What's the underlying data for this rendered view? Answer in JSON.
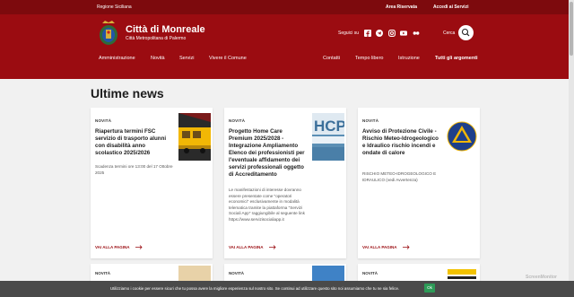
{
  "topbar": {
    "region": "Regione Siciliana",
    "reserved": "Area Riservata",
    "services": "Accedi ai Servizi"
  },
  "header": {
    "title": "Città di Monreale",
    "subtitle": "Città Metropolitana di Palermo",
    "social_label": "Seguici su",
    "social_icons": [
      "facebook-icon",
      "telegram-icon",
      "instagram-icon",
      "youtube-icon",
      "flickr-icon"
    ],
    "search_label": "Cerca",
    "nav_left": [
      "Amministrazione",
      "Novità",
      "Servizi",
      "Vivere il Comune"
    ],
    "nav_right": [
      "Contatti",
      "Tempo libero",
      "Istruzione",
      "Tutti gli argomenti"
    ]
  },
  "main": {
    "title": "Ultime news",
    "read_more": "VAI ALLA PAGINA",
    "cards": [
      {
        "category": "NOVITÀ",
        "title": "Riapertura termini FSC servizio di trasporto alunni con disabilità anno scolastico 2025/2026",
        "excerpt": "Scadenza termini ore 13:00 del 17 Ottobre 2025"
      },
      {
        "category": "NOVITÀ",
        "title": "Progetto Home Care Premium 2025/2028 - Integrazione Ampliamento Elenco dei professionisti per l'eventuale affidamento dei servizi professionali oggetto di Accreditamento",
        "excerpt": "Le manifestazioni di interesse dovranno essere presentate come \"operatori economici\" esclusivamente in modalità telematica tramite la piattaforma \"Servizi Sociali App\" raggiungibile al seguente link https://www.servizisocialiapp.it"
      },
      {
        "category": "NOVITÀ",
        "title": "Avviso di Protezione Civile - Rischio Meteo-Idrogeologico e Idraulico rischio incendi e ondate di calore",
        "excerpt": "RISCHIO METEO-IDROGEOLOGICO E IDRAULICO (vedi Avvertenza)"
      }
    ],
    "row2_categories": [
      "NOVITÀ",
      "NOVITÀ",
      "NOVITÀ"
    ]
  },
  "cookie": {
    "message": "Utilizziamo i cookie per essere sicuri che tu possa avere la migliore esperienza sul nostro sito. Se continui ad utilizzare questo sito noi assumiamo che tu ne sia felice.",
    "ok": "Ok"
  },
  "badge": "ScreenMonitor",
  "colors": {
    "brand": "#9b0c11",
    "brand_dark": "#7d0a0d",
    "accept": "#2d9a57"
  }
}
